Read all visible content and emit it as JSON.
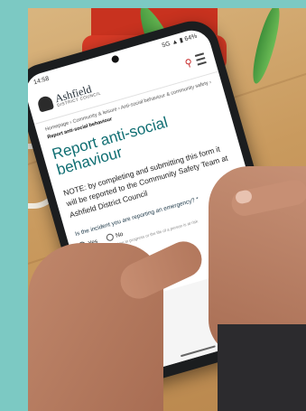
{
  "phone": {
    "status_time": "14:58",
    "status_right": "5G ▲ ▮ 64%",
    "logo_name": "Ashfield",
    "logo_sub": "DISTRICT COUNCIL",
    "breadcrumb": "Homepage › Community & leisure › Anti-social behaviour & community safety ›",
    "breadcrumb_current": "Report anti-social behaviour",
    "title": "Report anti-social behaviour",
    "note": "NOTE: by completing and submitting this form it will be reported to the Community Safety Team at Ashfield District Council",
    "question": "Is the incident you are reporting an emergency? *",
    "option_yes": "Yes",
    "option_no": "No",
    "hint": "An emergency is a crime in progress or the life of a person is at risk"
  }
}
